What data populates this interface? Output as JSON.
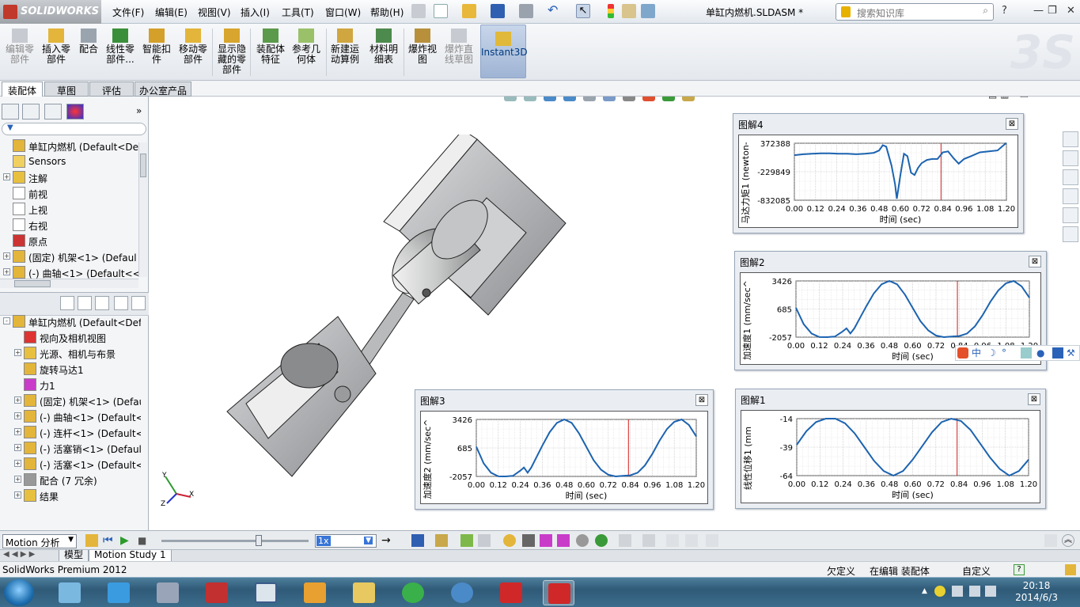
{
  "app": {
    "logo": "SOLIDWORKS",
    "doc_title": "单缸内燃机.SLDASM *"
  },
  "menu": [
    "文件(F)",
    "编辑(E)",
    "视图(V)",
    "插入(I)",
    "工具(T)",
    "窗口(W)",
    "帮助(H)"
  ],
  "search": {
    "placeholder": "搜索知识库"
  },
  "ribbon": [
    {
      "label": "编辑零部件",
      "disabled": true
    },
    {
      "label": "插入零部件",
      "disabled": false
    },
    {
      "label": "配合",
      "disabled": false
    },
    {
      "label": "线性零部件...",
      "disabled": false
    },
    {
      "label": "智能扣件",
      "disabled": false
    },
    {
      "label": "移动零部件",
      "disabled": false
    },
    {
      "label": "显示隐藏的零部件",
      "disabled": false
    },
    {
      "label": "装配体特征",
      "disabled": false
    },
    {
      "label": "参考几何体",
      "disabled": false
    },
    {
      "label": "新建运动算例",
      "disabled": false
    },
    {
      "label": "材料明细表",
      "disabled": false
    },
    {
      "label": "爆炸视图",
      "disabled": false
    },
    {
      "label": "爆炸直线草图",
      "disabled": true
    },
    {
      "label": "Instant3D",
      "disabled": false
    }
  ],
  "cm_tabs": [
    "装配体",
    "草图",
    "评估",
    "办公室产品"
  ],
  "feature_tree": [
    {
      "label": "单缸内燃机  (Default<Defa",
      "icon": "assembly-icon",
      "expander": ""
    },
    {
      "label": "Sensors",
      "icon": "sensor-icon",
      "expander": ""
    },
    {
      "label": "注解",
      "icon": "annotation-icon",
      "expander": "+"
    },
    {
      "label": "前视",
      "icon": "plane-icon",
      "expander": ""
    },
    {
      "label": "上视",
      "icon": "plane-icon",
      "expander": ""
    },
    {
      "label": "右视",
      "icon": "plane-icon",
      "expander": ""
    },
    {
      "label": "原点",
      "icon": "origin-icon",
      "expander": ""
    },
    {
      "label": "(固定) 机架<1> (Defaul",
      "icon": "part-icon",
      "expander": "+"
    },
    {
      "label": "(-) 曲轴<1> (Default<<",
      "icon": "part-icon",
      "expander": "+"
    }
  ],
  "motion_tree": [
    {
      "label": "单缸内燃机  (Default<Defa",
      "icon": "assembly-icon",
      "expander": "-"
    },
    {
      "label": "视向及相机视图",
      "icon": "camera-icon",
      "expander": ""
    },
    {
      "label": "光源、相机与布景",
      "icon": "lights-icon",
      "expander": "+"
    },
    {
      "label": "旋转马达1",
      "icon": "motor-icon",
      "expander": ""
    },
    {
      "label": "力1",
      "icon": "force-icon",
      "expander": ""
    },
    {
      "label": "(固定) 机架<1> (Defau",
      "icon": "part-icon",
      "expander": "+"
    },
    {
      "label": "(-) 曲轴<1> (Default<",
      "icon": "part-icon",
      "expander": "+"
    },
    {
      "label": "(-) 连杆<1> (Default<",
      "icon": "part-icon",
      "expander": "+"
    },
    {
      "label": "(-) 活塞销<1> (Default",
      "icon": "part-icon",
      "expander": "+"
    },
    {
      "label": "(-) 活塞<1> (Default<",
      "icon": "part-icon",
      "expander": "+"
    },
    {
      "label": "配合 (7 冗余)",
      "icon": "mates-icon",
      "expander": "+"
    },
    {
      "label": "结果",
      "icon": "results-icon",
      "expander": "+"
    }
  ],
  "triad": {
    "x": "X",
    "y": "Y",
    "z": "Z"
  },
  "plots": [
    {
      "id": "p4",
      "title": "图解4",
      "ylabel": "马达力矩1 (newton-",
      "xlabel": "时间 (sec)",
      "yticks": [
        "372388",
        "-229849",
        "-832085"
      ],
      "ymin": -832085,
      "ymax": 372388,
      "marker_x": 0.83,
      "x": [
        0,
        0.05,
        0.1,
        0.15,
        0.2,
        0.25,
        0.3,
        0.35,
        0.4,
        0.45,
        0.48,
        0.5,
        0.52,
        0.55,
        0.57,
        0.58,
        0.6,
        0.62,
        0.64,
        0.66,
        0.68,
        0.7,
        0.72,
        0.75,
        0.78,
        0.81,
        0.84,
        0.87,
        0.9,
        0.93,
        0.96,
        1.0,
        1.05,
        1.1,
        1.15,
        1.2
      ],
      "y": [
        120000,
        140000,
        150000,
        160000,
        160000,
        150000,
        150000,
        140000,
        150000,
        170000,
        220000,
        330000,
        300000,
        -100000,
        -500000,
        -800000,
        -300000,
        150000,
        100000,
        -250000,
        -300000,
        -150000,
        -50000,
        20000,
        40000,
        40000,
        180000,
        200000,
        60000,
        -60000,
        40000,
        100000,
        180000,
        200000,
        220000,
        380000
      ]
    },
    {
      "id": "p2",
      "title": "图解2",
      "ylabel": "加速度1 (mm/sec^",
      "xlabel": "时间 (sec)",
      "yticks": [
        "3426",
        "685",
        "-2057"
      ],
      "ymin": -2057,
      "ymax": 3426,
      "marker_x": 0.83,
      "x": [
        0,
        0.04,
        0.08,
        0.12,
        0.16,
        0.2,
        0.24,
        0.26,
        0.28,
        0.3,
        0.32,
        0.36,
        0.4,
        0.44,
        0.48,
        0.52,
        0.56,
        0.6,
        0.64,
        0.68,
        0.72,
        0.76,
        0.8,
        0.84,
        0.88,
        0.92,
        0.96,
        1.0,
        1.04,
        1.08,
        1.12,
        1.16,
        1.2
      ],
      "y": [
        800,
        -800,
        -1700,
        -2050,
        -2057,
        -2000,
        -1500,
        -1200,
        -1700,
        -1200,
        -500,
        900,
        2200,
        3100,
        3426,
        3100,
        2100,
        800,
        -500,
        -1400,
        -1900,
        -2057,
        -2000,
        -1950,
        -1700,
        -1000,
        100,
        1400,
        2500,
        3200,
        3426,
        2900,
        1800
      ]
    },
    {
      "id": "p3",
      "title": "图解3",
      "ylabel": "加速度2 (mm/sec^",
      "xlabel": "时间 (sec)",
      "yticks": [
        "3426",
        "685",
        "-2057"
      ],
      "ymin": -2057,
      "ymax": 3426,
      "marker_x": 0.83,
      "x": [
        0,
        0.04,
        0.08,
        0.12,
        0.16,
        0.2,
        0.24,
        0.26,
        0.28,
        0.3,
        0.32,
        0.36,
        0.4,
        0.44,
        0.48,
        0.52,
        0.56,
        0.6,
        0.64,
        0.68,
        0.72,
        0.76,
        0.8,
        0.84,
        0.88,
        0.92,
        0.96,
        1.0,
        1.04,
        1.08,
        1.12,
        1.16,
        1.2
      ],
      "y": [
        800,
        -800,
        -1700,
        -2050,
        -2057,
        -2000,
        -1500,
        -1200,
        -1700,
        -1200,
        -500,
        900,
        2200,
        3100,
        3426,
        3100,
        2100,
        800,
        -500,
        -1400,
        -1900,
        -2057,
        -2000,
        -1950,
        -1700,
        -1000,
        100,
        1400,
        2500,
        3200,
        3426,
        2900,
        1800
      ]
    },
    {
      "id": "p1",
      "title": "图解1",
      "ylabel": "线性位移1 (mm",
      "xlabel": "时间 (sec)",
      "yticks": [
        "-14",
        "-39",
        "-64"
      ],
      "ymin": -64,
      "ymax": -14,
      "marker_x": 0.83,
      "x": [
        0,
        0.05,
        0.1,
        0.15,
        0.2,
        0.25,
        0.3,
        0.35,
        0.4,
        0.45,
        0.5,
        0.55,
        0.6,
        0.65,
        0.7,
        0.75,
        0.8,
        0.85,
        0.9,
        0.95,
        1.0,
        1.05,
        1.1,
        1.15,
        1.2
      ],
      "y": [
        -37,
        -25,
        -17,
        -14,
        -14,
        -18,
        -27,
        -39,
        -51,
        -60,
        -64,
        -60,
        -50,
        -38,
        -26,
        -17,
        -14,
        -16,
        -24,
        -36,
        -48,
        -58,
        -64,
        -60,
        -50
      ]
    }
  ],
  "xticks": [
    "0.00",
    "0.12",
    "0.24",
    "0.36",
    "0.48",
    "0.60",
    "0.72",
    "0.84",
    "0.96",
    "1.08",
    "1.20"
  ],
  "motion": {
    "study_type": "Motion 分析",
    "speed": "1x",
    "time_fraction": 0.66
  },
  "bottom_tabs": [
    "模型",
    "Motion Study 1"
  ],
  "status": {
    "product": "SolidWorks Premium 2012",
    "underdefined": "欠定义",
    "editing": "在编辑 装配体",
    "custom": "自定义"
  },
  "tray": {
    "time": "20:18",
    "date": "2014/6/3"
  },
  "colors": {
    "series": "#1c63b0",
    "marker": "#d11a1a",
    "accent": "#c0392b"
  }
}
